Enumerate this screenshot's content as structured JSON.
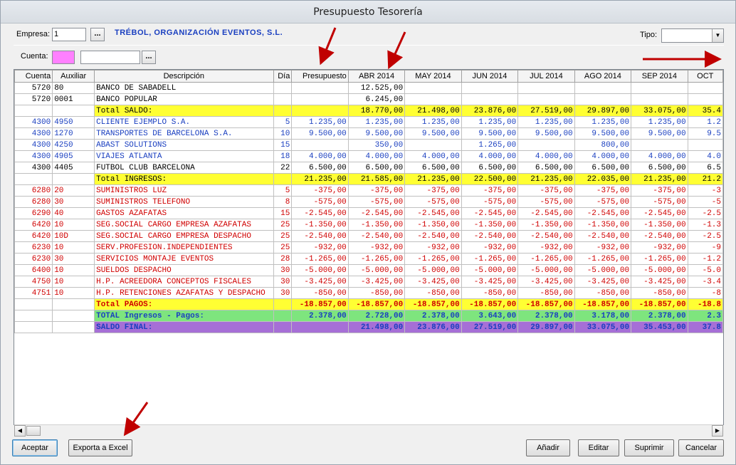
{
  "window": {
    "title": "Presupuesto Tesorería"
  },
  "filters": {
    "empresa_label": "Empresa:",
    "empresa_value": "1",
    "ellipsis": "...",
    "company_name": "TRÉBOL, ORGANIZACIÓN EVENTOS, S.L.",
    "cuenta_label": "Cuenta:",
    "cuenta_value": "",
    "tipo_label": "Tipo:",
    "tipo_value": "",
    "cuenta_color": "#ff80ff"
  },
  "grid": {
    "headers": [
      "Cuenta",
      "Auxiliar",
      "Descripción",
      "Día",
      "Presupuesto",
      "ABR 2014",
      "MAY 2014",
      "JUN 2014",
      "JUL 2014",
      "AGO 2014",
      "SEP 2014",
      "OCT"
    ],
    "rows": [
      {
        "style": "black",
        "cuenta": "5720",
        "aux": "80",
        "desc": "BANCO DE SABADELL",
        "dia": "",
        "pres": "",
        "months": [
          "12.525,00",
          "",
          "",
          "",
          "",
          "",
          ""
        ]
      },
      {
        "style": "black",
        "cuenta": "5720",
        "aux": "0001",
        "desc": "BANCO POPULAR",
        "dia": "",
        "pres": "",
        "months": [
          "6.245,00",
          "",
          "",
          "",
          "",
          "",
          ""
        ]
      },
      {
        "style": "black total-yellow",
        "cuenta": "",
        "aux": "",
        "desc": "   Total SALDO:",
        "dia": "",
        "pres": "",
        "months": [
          "18.770,00",
          "21.498,00",
          "23.876,00",
          "27.519,00",
          "29.897,00",
          "33.075,00",
          "35.4"
        ]
      },
      {
        "style": "blue",
        "cuenta": "4300",
        "aux": "4950",
        "desc": "CLIENTE EJEMPLO S.A.",
        "dia": "5",
        "pres": "1.235,00",
        "months": [
          "1.235,00",
          "1.235,00",
          "1.235,00",
          "1.235,00",
          "1.235,00",
          "1.235,00",
          "1.2"
        ]
      },
      {
        "style": "blue",
        "cuenta": "4300",
        "aux": "1270",
        "desc": "TRANSPORTES DE BARCELONA S.A.",
        "dia": "10",
        "pres": "9.500,00",
        "months": [
          "9.500,00",
          "9.500,00",
          "9.500,00",
          "9.500,00",
          "9.500,00",
          "9.500,00",
          "9.5"
        ]
      },
      {
        "style": "blue",
        "cuenta": "4300",
        "aux": "4250",
        "desc": "ABAST SOLUTIONS",
        "dia": "15",
        "pres": "",
        "months": [
          "350,00",
          "",
          "1.265,00",
          "",
          "800,00",
          "",
          ""
        ]
      },
      {
        "style": "blue",
        "cuenta": "4300",
        "aux": "4905",
        "desc": "VIAJES ATLANTA",
        "dia": "18",
        "pres": "4.000,00",
        "months": [
          "4.000,00",
          "4.000,00",
          "4.000,00",
          "4.000,00",
          "4.000,00",
          "4.000,00",
          "4.0"
        ]
      },
      {
        "style": "black",
        "cuenta": "4300",
        "aux": "4405",
        "desc": "FUTBOL CLUB BARCELONA",
        "dia": "22",
        "pres": "6.500,00",
        "months": [
          "6.500,00",
          "6.500,00",
          "6.500,00",
          "6.500,00",
          "6.500,00",
          "6.500,00",
          "6.5"
        ]
      },
      {
        "style": "black total-yellow",
        "cuenta": "",
        "aux": "",
        "desc": "   Total INGRESOS:",
        "dia": "",
        "pres": "21.235,00",
        "months": [
          "21.585,00",
          "21.235,00",
          "22.500,00",
          "21.235,00",
          "22.035,00",
          "21.235,00",
          "21.2"
        ]
      },
      {
        "style": "red",
        "cuenta": "6280",
        "aux": "20",
        "desc": "SUMINISTROS LUZ",
        "dia": "5",
        "pres": "-375,00",
        "months": [
          "-375,00",
          "-375,00",
          "-375,00",
          "-375,00",
          "-375,00",
          "-375,00",
          "-3"
        ]
      },
      {
        "style": "red",
        "cuenta": "6280",
        "aux": "30",
        "desc": "SUMINISTROS TELEFONO",
        "dia": "8",
        "pres": "-575,00",
        "months": [
          "-575,00",
          "-575,00",
          "-575,00",
          "-575,00",
          "-575,00",
          "-575,00",
          "-5"
        ]
      },
      {
        "style": "red",
        "cuenta": "6290",
        "aux": "40",
        "desc": "GASTOS AZAFATAS",
        "dia": "15",
        "pres": "-2.545,00",
        "months": [
          "-2.545,00",
          "-2.545,00",
          "-2.545,00",
          "-2.545,00",
          "-2.545,00",
          "-2.545,00",
          "-2.5"
        ]
      },
      {
        "style": "red",
        "cuenta": "6420",
        "aux": "10",
        "desc": "SEG.SOCIAL CARGO EMPRESA AZAFATAS",
        "dia": "25",
        "pres": "-1.350,00",
        "months": [
          "-1.350,00",
          "-1.350,00",
          "-1.350,00",
          "-1.350,00",
          "-1.350,00",
          "-1.350,00",
          "-1.3"
        ]
      },
      {
        "style": "red",
        "cuenta": "6420",
        "aux": "10D",
        "desc": "SEG.SOCIAL CARGO EMPRESA DESPACHO",
        "dia": "25",
        "pres": "-2.540,00",
        "months": [
          "-2.540,00",
          "-2.540,00",
          "-2.540,00",
          "-2.540,00",
          "-2.540,00",
          "-2.540,00",
          "-2.5"
        ]
      },
      {
        "style": "red",
        "cuenta": "6230",
        "aux": "10",
        "desc": "SERV.PROFESION.INDEPENDIENTES",
        "dia": "25",
        "pres": "-932,00",
        "months": [
          "-932,00",
          "-932,00",
          "-932,00",
          "-932,00",
          "-932,00",
          "-932,00",
          "-9"
        ]
      },
      {
        "style": "red",
        "cuenta": "6230",
        "aux": "30",
        "desc": "SERVICIOS MONTAJE EVENTOS",
        "dia": "28",
        "pres": "-1.265,00",
        "months": [
          "-1.265,00",
          "-1.265,00",
          "-1.265,00",
          "-1.265,00",
          "-1.265,00",
          "-1.265,00",
          "-1.2"
        ]
      },
      {
        "style": "red",
        "cuenta": "6400",
        "aux": "10",
        "desc": "SUELDOS DESPACHO",
        "dia": "30",
        "pres": "-5.000,00",
        "months": [
          "-5.000,00",
          "-5.000,00",
          "-5.000,00",
          "-5.000,00",
          "-5.000,00",
          "-5.000,00",
          "-5.0"
        ]
      },
      {
        "style": "red",
        "cuenta": "4750",
        "aux": "10",
        "desc": "H.P. ACREEDORA CONCEPTOS FISCALES",
        "dia": "30",
        "pres": "-3.425,00",
        "months": [
          "-3.425,00",
          "-3.425,00",
          "-3.425,00",
          "-3.425,00",
          "-3.425,00",
          "-3.425,00",
          "-3.4"
        ]
      },
      {
        "style": "red",
        "cuenta": "4751",
        "aux": "10",
        "desc": "H.P. RETENCIONES AZAFATAS Y DESPACHO",
        "dia": "30",
        "pres": "-850,00",
        "months": [
          "-850,00",
          "-850,00",
          "-850,00",
          "-850,00",
          "-850,00",
          "-850,00",
          "-8"
        ]
      },
      {
        "style": "red bold total-yellow",
        "cuenta": "",
        "aux": "",
        "desc": "Total PAGOS:",
        "dia": "",
        "pres": "-18.857,00",
        "months": [
          "-18.857,00",
          "-18.857,00",
          "-18.857,00",
          "-18.857,00",
          "-18.857,00",
          "-18.857,00",
          "-18.8"
        ]
      },
      {
        "style": "blue bold total-green",
        "cuenta": "",
        "aux": "",
        "desc": "  TOTAL Ingresos - Pagos:",
        "dia": "",
        "pres": "2.378,00",
        "months": [
          "2.728,00",
          "2.378,00",
          "3.643,00",
          "2.378,00",
          "3.178,00",
          "2.378,00",
          "2.3"
        ]
      },
      {
        "style": "blue bold total-purple",
        "cuenta": "",
        "aux": "",
        "desc": "   SALDO FINAL:",
        "dia": "",
        "pres": "",
        "months": [
          "21.498,00",
          "23.876,00",
          "27.519,00",
          "29.897,00",
          "33.075,00",
          "35.453,00",
          "37.8"
        ]
      }
    ]
  },
  "buttons": {
    "aceptar": "Aceptar",
    "exporta": "Exporta a Excel",
    "anadir": "Añadir",
    "editar": "Editar",
    "suprimir": "Suprimir",
    "cancelar": "Cancelar"
  },
  "colors": {
    "highlight_yellow": "#ffff33",
    "highlight_green": "#7ee57e",
    "highlight_purple": "#a66fd6",
    "income_blue": "#1a3fc0",
    "payment_red": "#d00000",
    "annotation_arrow": "#c00000"
  }
}
